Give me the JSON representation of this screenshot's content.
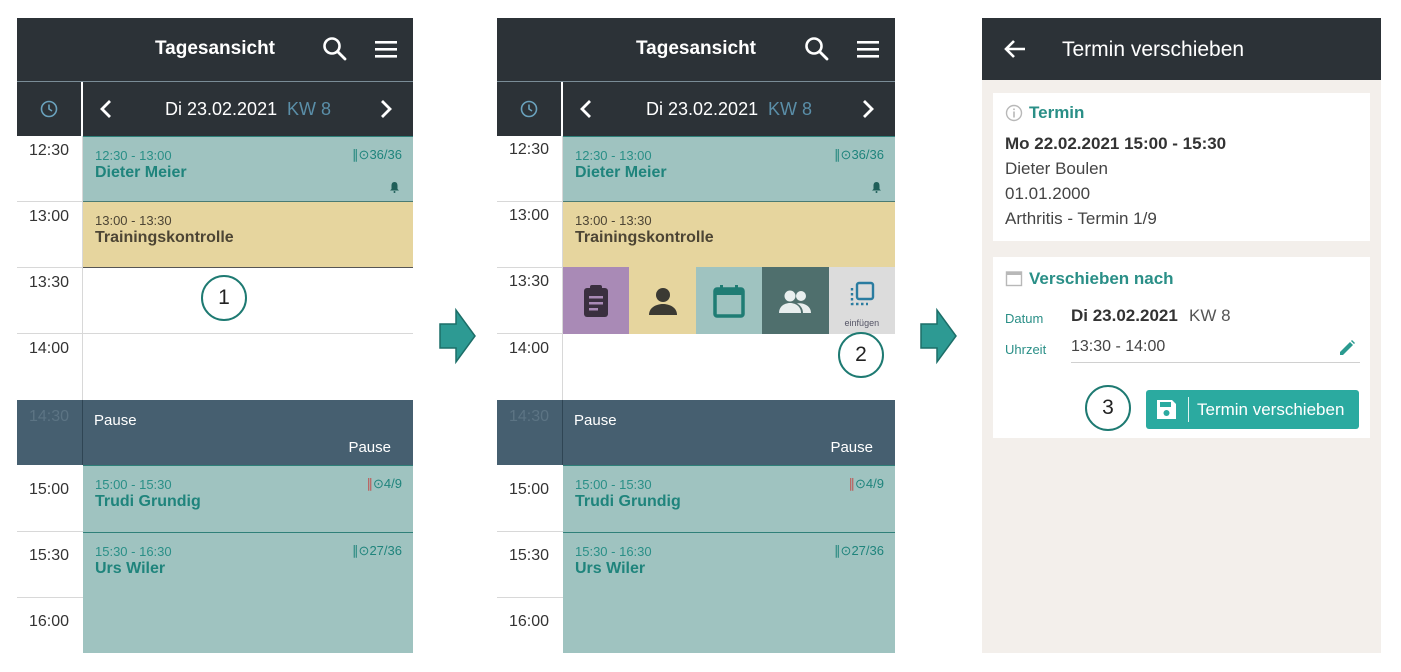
{
  "colors": {
    "header": "#2c3237",
    "teal_appointment": "#9fc3c0",
    "yellow_appointment": "#e6d59e",
    "pause": "#465f70",
    "accent": "#2baaa0"
  },
  "day_view": {
    "title": "Tagesansicht",
    "date": "Di 23.02.2021",
    "week": "KW 8",
    "icons": [
      "search-icon",
      "menu-icon",
      "clock-icon",
      "chevron-left-icon",
      "chevron-right-icon"
    ],
    "times": [
      "12:30",
      "13:00",
      "13:30",
      "14:00",
      "14:30",
      "15:00",
      "15:30",
      "16:00"
    ],
    "appointments": [
      {
        "time": "12:30 - 13:00",
        "name": "Dieter Meier",
        "info": "36/36"
      },
      {
        "time": "13:00 - 13:30",
        "name": "Trainingskontrolle"
      },
      {
        "time": "15:00 - 15:30",
        "name": "Trudi Grundig",
        "info": "4/9"
      },
      {
        "time": "15:30 - 16:30",
        "name": "Urs Wiler",
        "info": "27/36"
      }
    ],
    "pause": {
      "label_left": "Pause",
      "label_right": "Pause"
    }
  },
  "quick_actions": {
    "items": [
      "clipboard-icon",
      "person-icon",
      "calendar-icon",
      "group-icon",
      "paste-icon"
    ],
    "insert_label": "einfügen"
  },
  "steps": [
    "1",
    "2",
    "3"
  ],
  "move_screen": {
    "title": "Termin verschieben",
    "termin": {
      "header": "Termin",
      "datetime": "Mo 22.02.2021 15:00 - 15:30",
      "patient": "Dieter Boulen",
      "birthdate": "01.01.2000",
      "series": "Arthritis - Termin 1/9"
    },
    "move_to": {
      "header": "Verschieben nach",
      "date_label": "Datum",
      "date_value": "Di 23.02.2021",
      "week": "KW 8",
      "time_label": "Uhrzeit",
      "time_value": "13:30 - 14:00"
    },
    "save_button": "Termin verschieben"
  }
}
